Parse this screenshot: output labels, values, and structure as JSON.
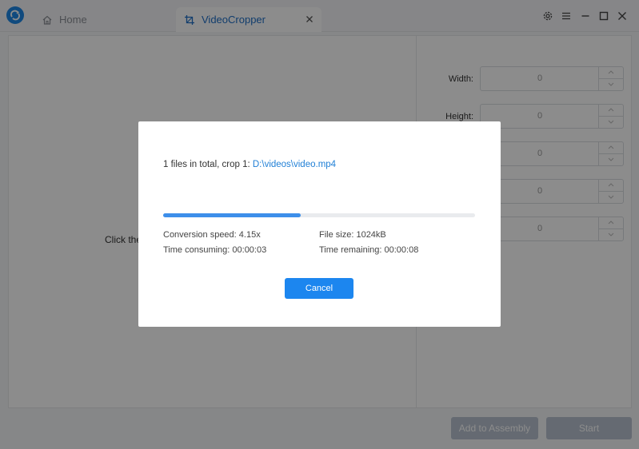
{
  "titlebar": {
    "tabs": [
      {
        "label": "Home"
      },
      {
        "label": "VideoCropper"
      }
    ]
  },
  "workarea": {
    "hint": "Click the",
    "fields": [
      {
        "label": "Width:",
        "value": "0"
      },
      {
        "label": "Height:",
        "value": "0"
      },
      {
        "label": "",
        "value": "0"
      },
      {
        "label": "",
        "value": "0"
      },
      {
        "label": "",
        "value": "0"
      }
    ]
  },
  "buttons": {
    "add_to_assembly": "Add to Assembly",
    "start": "Start"
  },
  "dialog": {
    "summary_prefix": "1 files in total, crop 1: ",
    "file_path": "D:\\videos\\video.mp4",
    "progress_percent": 44,
    "conversion_speed": "Conversion speed: 4.15x",
    "file_size": "File size: 1024kB",
    "time_consuming": "Time consuming: 00:00:03",
    "time_remaining": "Time remaining: 00:00:08",
    "cancel_label": "Cancel"
  },
  "colors": {
    "accent": "#1c86ef",
    "progress": "#3d8fea",
    "link": "#1f7fd6"
  },
  "icons": {
    "app_logo": "app-logo-icon",
    "home": "home-icon",
    "crop": "crop-icon",
    "close_tab": "close-icon",
    "settings": "gear-icon",
    "menu": "menu-icon",
    "minimize": "minimize-icon",
    "maximize": "maximize-icon",
    "close_window": "close-window-icon"
  }
}
